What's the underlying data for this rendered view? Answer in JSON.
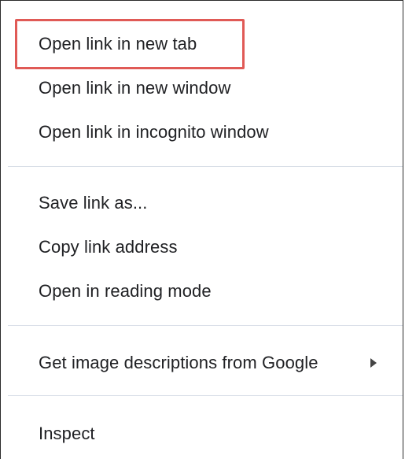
{
  "context_menu": {
    "items": [
      {
        "label": "Open link in new tab"
      },
      {
        "label": "Open link in new window"
      },
      {
        "label": "Open link in incognito window"
      },
      {
        "label": "Save link as..."
      },
      {
        "label": "Copy link address"
      },
      {
        "label": "Open in reading mode"
      },
      {
        "label": "Get image descriptions from Google",
        "submenu_icon": "chevron-right-icon"
      },
      {
        "label": "Inspect"
      }
    ],
    "highlighted_item": "Open link in new tab",
    "highlight_color": "#e05a56",
    "separator_color": "#d8dee7",
    "text_color": "#202124"
  }
}
